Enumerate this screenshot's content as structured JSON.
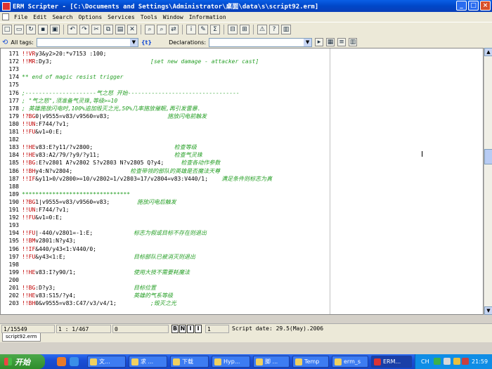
{
  "window": {
    "title": "ERM Scripter - [C:\\Documents and Settings\\Administrator\\桌面\\data\\s\\script92.erm]",
    "buttons": [
      "_",
      "□",
      "×"
    ]
  },
  "menu": [
    "File",
    "Edit",
    "Search",
    "Options",
    "Services",
    "Tools",
    "Window",
    "Information"
  ],
  "toolbar": {
    "icons": [
      "new-icon",
      "open-icon",
      "refresh-icon",
      "save-icon",
      "save-all-icon",
      "undo-icon",
      "redo-icon",
      "cut-icon",
      "copy-icon",
      "paste-icon",
      "delete-icon",
      "find-icon",
      "find-next-icon",
      "replace-icon",
      "info-icon",
      "comment-icon",
      "sum-icon",
      "compare-icon",
      "tree-icon",
      "warning-icon",
      "help-icon",
      "book-icon"
    ]
  },
  "toolbar2": {
    "all_tags_label": "All tags:",
    "declarations_label": "Declarations:"
  },
  "editor": {
    "lines": [
      {
        "n": "171",
        "kw": "!!VR",
        "code": "y3&y2>20:*v7153 :100;",
        "cm": ""
      },
      {
        "n": "172",
        "kw": "!!MR",
        "code": ":Dy3;",
        "cm": "                             [set new damage - attacker cast]"
      },
      {
        "n": "173",
        "kw": "",
        "code": "",
        "cm": ""
      },
      {
        "n": "174",
        "kw": "",
        "code": "",
        "cm": "** end of magic resist trigger"
      },
      {
        "n": "175",
        "kw": "",
        "code": "",
        "cm": ""
      },
      {
        "n": "176",
        "kw": "",
        "code": "",
        "cm": ";---------------------气之怒 开始---------------------------------"
      },
      {
        "n": "177",
        "kw": "",
        "code": "",
        "cm": "; \"气之怒\",须准备气灵珠,等级>=10"
      },
      {
        "n": "178",
        "kw": "",
        "code": "",
        "cm": "; 英雄施放闪电时,100%追加毁灭之光,50%几率施放催眠,再引发雷暴."
      },
      {
        "n": "179",
        "kw": "!?BG",
        "code": "0|v9555=v83/v9560=v83;",
        "cm": "                 施放闪电前触发"
      },
      {
        "n": "180",
        "kw": "!!UN",
        "code": ":F744/?v1;",
        "cm": ""
      },
      {
        "n": "181",
        "kw": "!!FU",
        "code": "&v1=0:E;",
        "cm": ""
      },
      {
        "n": "182",
        "kw": "",
        "code": "",
        "cm": ""
      },
      {
        "n": "183",
        "kw": "!!HE",
        "code": "v83:E?y11/?v2800;",
        "cm": "                        检查等级"
      },
      {
        "n": "184",
        "kw": "!!HE",
        "code": "v83:A2/79/?y9/?y11;",
        "cm": "                      检查气灵珠"
      },
      {
        "n": "185",
        "kw": "!!BG",
        "code": ":E?v2801 A?v2802 S?v2803 N?v2805 Q?y4;",
        "cm": "     检查各动作参数"
      },
      {
        "n": "186",
        "kw": "!!BH",
        "code": "y4:N?v2804;",
        "cm": "                 检查带领的部队的英雄是否魔法天尊"
      },
      {
        "n": "187",
        "kw": "!!IF",
        "code": "&y11>0/v2800>=10/v2802=1/v2803=17/v2804=v83:V440/1;",
        "cm": "    满足条件则标志为真"
      },
      {
        "n": "188",
        "kw": "",
        "code": "",
        "cm": ""
      },
      {
        "n": "189",
        "kw": "",
        "code": "",
        "cm": "********************************"
      },
      {
        "n": "190",
        "kw": "!?BG",
        "code": "1|v9555=v83/v9560=v83;",
        "cm": "        施放闪电后触发"
      },
      {
        "n": "191",
        "kw": "!!UN",
        "code": ":F744/?v1;",
        "cm": ""
      },
      {
        "n": "192",
        "kw": "!!FU",
        "code": "&v1=0:E;",
        "cm": ""
      },
      {
        "n": "193",
        "kw": "",
        "code": "",
        "cm": ""
      },
      {
        "n": "194",
        "kw": "!!FU",
        "code": "|-440/v2801=-1:E;",
        "cm": "            标志为假或目标不存在则退出"
      },
      {
        "n": "195",
        "kw": "!!BM",
        "code": "v2801:N?y43;",
        "cm": ""
      },
      {
        "n": "196",
        "kw": "!!IF",
        "code": "&440/y43<1:V440/0;",
        "cm": ""
      },
      {
        "n": "197",
        "kw": "!!FU",
        "code": "&y43<1:E;",
        "cm": "                    目标部队已被消灭则退出"
      },
      {
        "n": "198",
        "kw": "",
        "code": "",
        "cm": ""
      },
      {
        "n": "199",
        "kw": "!!HE",
        "code": "v83:I?y90/1;",
        "cm": "                 使用大技不需要耗魔法"
      },
      {
        "n": "200",
        "kw": "",
        "code": "",
        "cm": ""
      },
      {
        "n": "201",
        "kw": "!!BG",
        "code": ":D?y3;",
        "cm": "                       目标位置"
      },
      {
        "n": "202",
        "kw": "!!HE",
        "code": "v83:S15/?y4;",
        "cm": "                 英雄的气系等级"
      },
      {
        "n": "203",
        "kw": "!!BH",
        "code": "0&v9555=v83:C47/v3/v4/1;",
        "cm": "          ;毁灭之光"
      }
    ]
  },
  "status": {
    "lines": "1/15549",
    "pos": "1 : 1/467",
    "col": "0",
    "fmt_buttons": [
      "B",
      "N",
      "I",
      "I"
    ],
    "page": "1",
    "script_date": "Script date: 29.5(May).2006"
  },
  "tab": "script92.erm",
  "taskbar": {
    "start": "开始",
    "tasks": [
      "文...",
      "求 ...",
      "下载",
      "Hyp...",
      "脚 ...",
      "Temp",
      "erm_s",
      "ERM..."
    ],
    "tray_lang": "CH",
    "clock": "21:59"
  }
}
